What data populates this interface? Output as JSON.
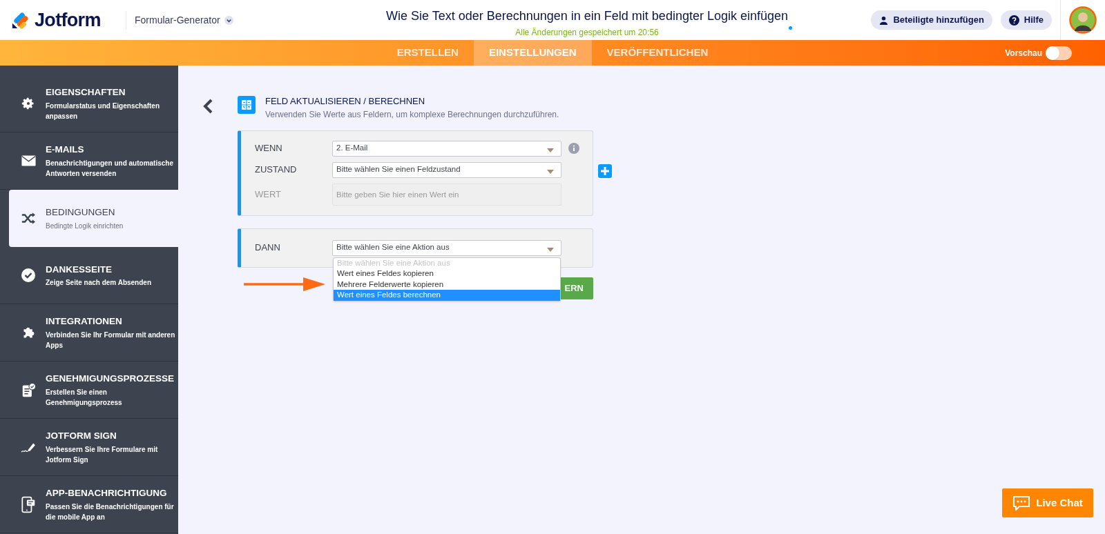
{
  "header": {
    "logo": "Jotform",
    "product": "Formular-Generator",
    "title": "Wie Sie Text oder Berechnungen in ein Feld mit bedingter Logik einfügen",
    "saved_status": "Alle Änderungen gespeichert um 20:56",
    "buttons": [
      "Beteiligte hinzufügen",
      "Hilfe"
    ]
  },
  "nav": {
    "tabs": [
      {
        "label": "ERSTELLEN",
        "selected": false
      },
      {
        "label": "EINSTELLUNGEN",
        "selected": true
      },
      {
        "label": "VERÖFFENTLICHEN",
        "selected": false
      }
    ],
    "preview": {
      "label": "Vorschau",
      "on": false
    }
  },
  "sidebar": {
    "items": [
      {
        "title": "EIGENSCHAFTEN",
        "subtitle": "Formularstatus und Eigenschaften anpassen",
        "selected": false
      },
      {
        "title": "E-MAILS",
        "subtitle": "Benachrichtigungen und automatische Antworten versenden",
        "selected": false
      },
      {
        "title": "BEDINGUNGEN",
        "subtitle": "Bedingte Logik einrichten",
        "selected": true
      },
      {
        "title": "DANKESSEITE",
        "subtitle": "Zeige Seite nach dem Absenden",
        "selected": false
      },
      {
        "title": "INTEGRATIONEN",
        "subtitle": "Verbinden Sie Ihr Formular mit anderen Apps",
        "selected": false
      },
      {
        "title": "GENEHMIGUNGSPROZESSE",
        "subtitle": "Erstellen Sie einen Genehmigungsprozess",
        "selected": false
      },
      {
        "title": "JOTFORM SIGN",
        "subtitle": "Verbessern Sie Ihre Formulare mit Jotform Sign",
        "selected": false
      },
      {
        "title": "APP-BENACHRICHTIGUNG",
        "subtitle": "Passen Sie die Benachrichtigungen für die mobile App an",
        "selected": false
      }
    ]
  },
  "condition": {
    "title": "FELD AKTUALISIEREN / BERECHNEN",
    "subtitle": "Verwenden Sie Werte aus Feldern, um komplexe Berechnungen durchzuführen.",
    "if_rows": [
      {
        "label": "WENN",
        "kind": "select",
        "value": "2. E-Mail",
        "disabled": false
      },
      {
        "label": "ZUSTAND",
        "kind": "select",
        "value": "Bitte wählen Sie einen Feldzustand",
        "disabled": false
      },
      {
        "label": "WERT",
        "kind": "input",
        "placeholder": "Bitte geben Sie hier einen Wert ein",
        "disabled": true
      }
    ],
    "then": {
      "label": "DANN",
      "value": "Bitte wählen Sie eine Aktion aus"
    },
    "options": [
      {
        "label": "Bitte wählen Sie eine Aktion aus",
        "disabled": true,
        "selected": false
      },
      {
        "label": "Wert eines Feldes kopieren",
        "disabled": false,
        "selected": false
      },
      {
        "label": "Mehrere Felderwerte kopieren",
        "disabled": false,
        "selected": false
      },
      {
        "label": "Wert eines Feldes berechnen",
        "disabled": false,
        "selected": true
      }
    ],
    "save_button": "ERN"
  },
  "live_chat": "Live Chat"
}
